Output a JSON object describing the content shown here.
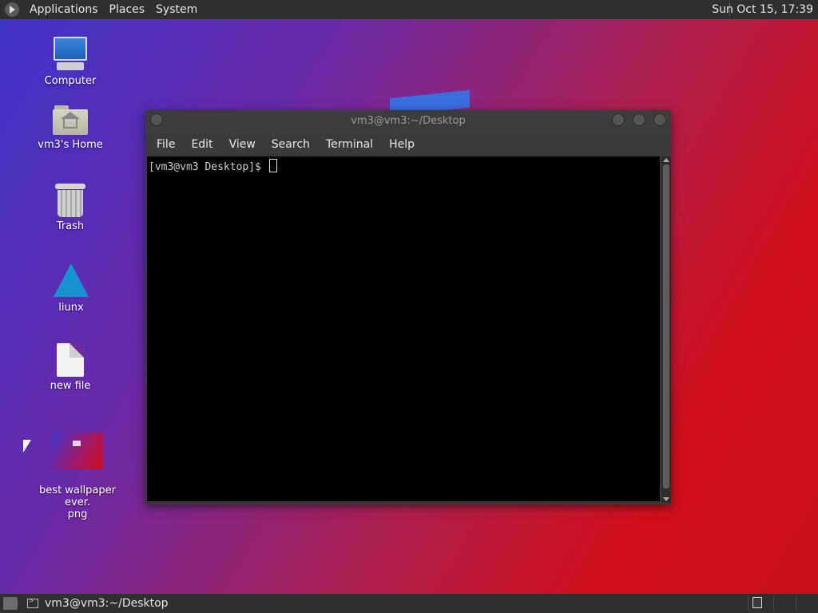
{
  "top_panel": {
    "applications": "Applications",
    "places": "Places",
    "system": "System",
    "clock": "Sun Oct 15, 17:39"
  },
  "desktop": {
    "icons": [
      {
        "label": "Computer",
        "icon": "computer-icon"
      },
      {
        "label": "vm3's Home",
        "icon": "home-folder-icon"
      },
      {
        "label": "Trash",
        "icon": "trash-icon"
      },
      {
        "label": "liunx",
        "icon": "arch-linux-icon"
      },
      {
        "label": "new file",
        "icon": "file-icon"
      },
      {
        "label": "best wallpaper ever.\npng",
        "icon": "image-file-icon"
      }
    ]
  },
  "terminal": {
    "title": "vm3@vm3:~/Desktop",
    "menu": [
      "File",
      "Edit",
      "View",
      "Search",
      "Terminal",
      "Help"
    ],
    "prompt": "[vm3@vm3 Desktop]$ "
  },
  "bottom_panel": {
    "task_label": "vm3@vm3:~/Desktop"
  },
  "colors": {
    "panel": "#2f2f2f",
    "terminal_bg": "#000000",
    "wallpaper_start": "#3d32c8",
    "wallpaper_end": "#d10f1c"
  }
}
